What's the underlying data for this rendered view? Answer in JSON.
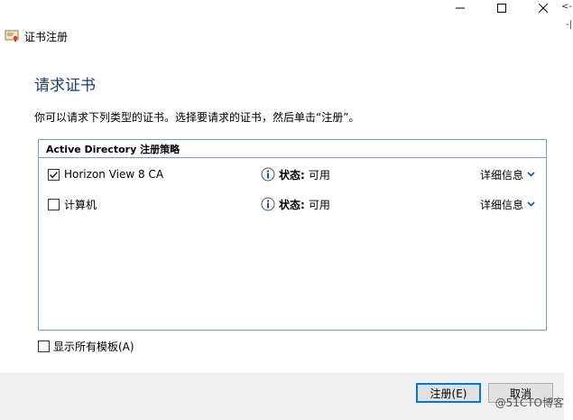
{
  "window": {
    "title": "证书注册",
    "controls": [
      "minimize-icon",
      "maximize-icon",
      "close-icon"
    ]
  },
  "edge_glyphs": [
    "<-",
    "-|"
  ],
  "main": {
    "heading": "请求证书",
    "instruction": "你可以请求下列类型的证书。选择要请求的证书，然后单击“注册”。",
    "policy_header": "Active Directory 注册策略",
    "templates": [
      {
        "name": "Horizon View 8 CA",
        "checked": true,
        "status_label": "状态:",
        "status_value": "可用",
        "details_label": "详细信息"
      },
      {
        "name": "计算机",
        "checked": false,
        "status_label": "状态:",
        "status_value": "可用",
        "details_label": "详细信息"
      }
    ],
    "show_all_label": "显示所有模板(A)"
  },
  "footer": {
    "enroll_label": "注册(E)",
    "cancel_label": "取消"
  },
  "watermark": "@51CTO博客",
  "colors": {
    "heading": "#1f3d7a",
    "border": "#7a9cc6",
    "footer_bg": "#f0f0f0",
    "primary_border": "#0078d7"
  }
}
